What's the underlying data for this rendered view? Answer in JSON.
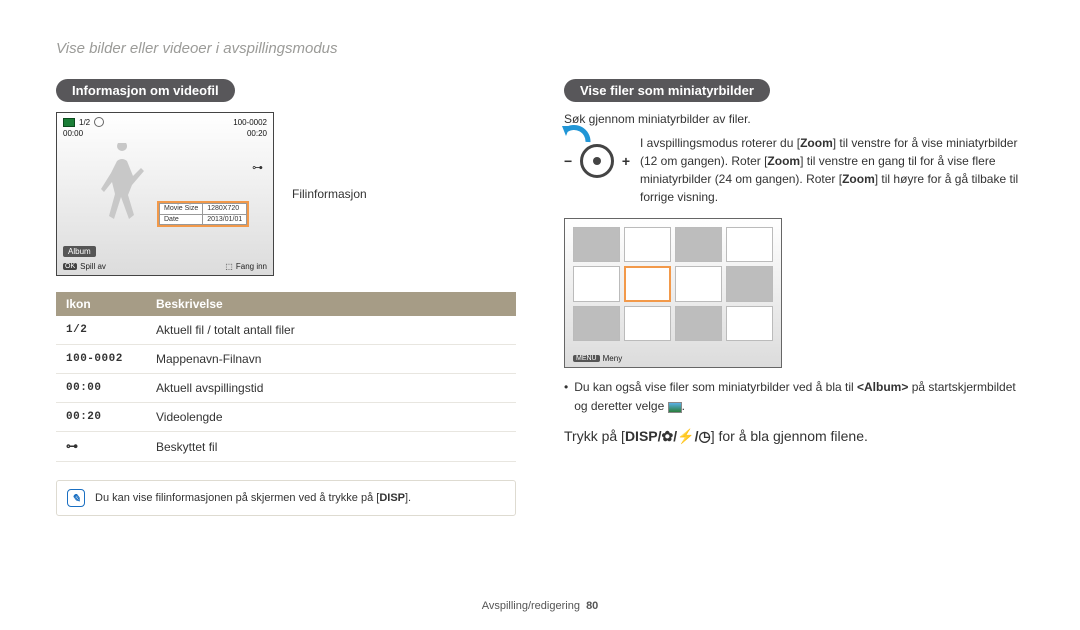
{
  "breadcrumb": "Vise bilder eller videoer i avspillingsmodus",
  "left": {
    "heading": "Informasjon om videofil",
    "preview": {
      "counter": "1/2",
      "folderfile": "100-0002",
      "time_current": "00:00",
      "time_total": "00:20",
      "overlay": {
        "row1_label": "Movie Size",
        "row1_val": "1280X720",
        "row2_label": "Date",
        "row2_val": "2013/01/01"
      },
      "album_btn": "Album",
      "spill_av_label": "Spill av",
      "ok_chip": "OK",
      "fang_inn_label": "Fang inn"
    },
    "file_info_label": "Filinformasjon",
    "table": {
      "th_icon": "Ikon",
      "th_desc": "Beskrivelse",
      "r1_icon": "1/2",
      "r1_desc": "Aktuell fil / totalt antall filer",
      "r2_icon": "100-0002",
      "r2_desc": "Mappenavn-Filnavn",
      "r3_icon": "00:00",
      "r3_desc": "Aktuell avspillingstid",
      "r4_icon": "00:20",
      "r4_desc": "Videolengde",
      "r5_desc": "Beskyttet fil"
    },
    "note_text_pre": "Du kan vise filinformasjonen på skjermen ved å trykke på [",
    "note_disp": "DISP",
    "note_text_post": "]."
  },
  "right": {
    "heading": "Vise filer som miniatyrbilder",
    "subhead": "Søk gjennom miniatyrbilder av filer.",
    "zoom_text_1": "I avspillingsmodus roterer du [",
    "zoom_b1": "Zoom",
    "zoom_text_2": "] til venstre for å vise miniatyrbilder (12 om gangen). Roter [",
    "zoom_b2": "Zoom",
    "zoom_text_3": "] til venstre en gang til for å vise flere miniatyrbilder (24 om gangen). Roter [",
    "zoom_b3": "Zoom",
    "zoom_text_4": "] til høyre for å gå tilbake til forrige visning.",
    "menu_chip": "MENU",
    "menu_label": "Meny",
    "bullet_text_pre": "Du kan også vise filer som miniatyrbilder ved å bla til ",
    "bullet_b": "<Album>",
    "bullet_text_post": " på startskjermbildet og deretter velge ",
    "instruction_pre": "Trykk på [",
    "instruction_disp": "DISP",
    "instruction_post": "] for å bla gjennom filene."
  },
  "footer": {
    "section": "Avspilling/redigering",
    "page": "80"
  }
}
